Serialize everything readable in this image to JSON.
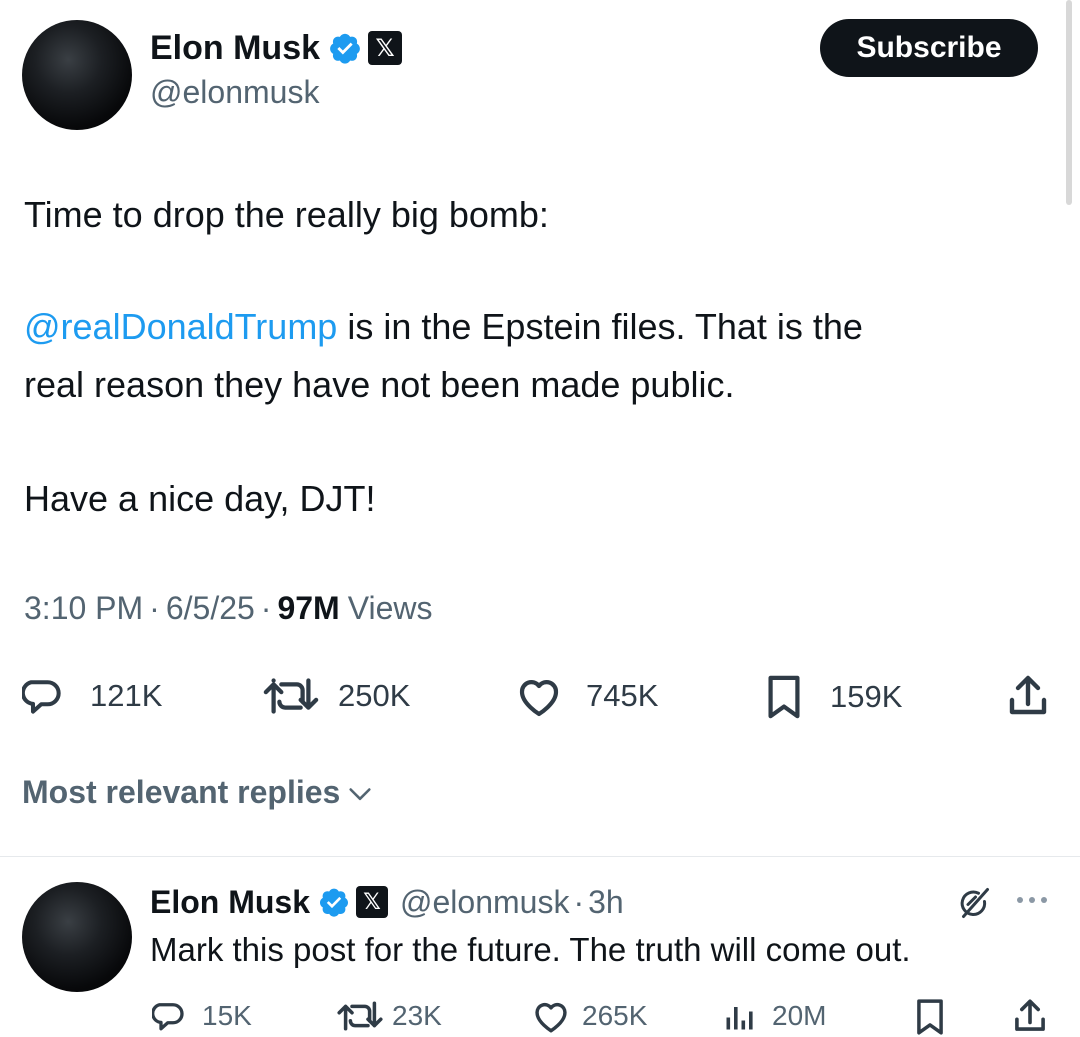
{
  "post": {
    "author_name": "Elon Musk",
    "author_handle": "@elonmusk",
    "subscribe_label": "Subscribe",
    "text_line1": "Time to drop the really big bomb:",
    "mention": "@realDonaldTrump",
    "text_line2_rest": " is in the Epstein files. That is the",
    "text_line3": "real reason they have not been made public.",
    "text_line4": "Have a nice day, DJT!",
    "time": "3:10 PM",
    "date": "6/5/25",
    "views_count": "97M",
    "views_label": "Views",
    "separator": "·",
    "replies": "121K",
    "reposts": "250K",
    "likes": "745K",
    "bookmarks": "159K"
  },
  "replies_filter": {
    "label": "Most relevant replies"
  },
  "reply": {
    "author_name": "Elon Musk",
    "author_handle": "@elonmusk",
    "separator": "·",
    "time_ago": "3h",
    "text": "Mark this post for the future. The truth will come out.",
    "replies": "15K",
    "reposts": "23K",
    "likes": "265K",
    "views": "20M"
  },
  "icons": {
    "verified": "verified-badge-icon",
    "x_logo": "x-logo-icon",
    "reply": "reply-icon",
    "repost": "repost-icon",
    "like": "heart-icon",
    "bookmark": "bookmark-icon",
    "share": "share-icon",
    "views": "views-icon",
    "grok": "grok-icon",
    "more": "more-icon",
    "chevron": "chevron-down-icon"
  },
  "colors": {
    "accent": "#1d9bf0",
    "text": "#0f1419",
    "secondary": "#536471"
  }
}
